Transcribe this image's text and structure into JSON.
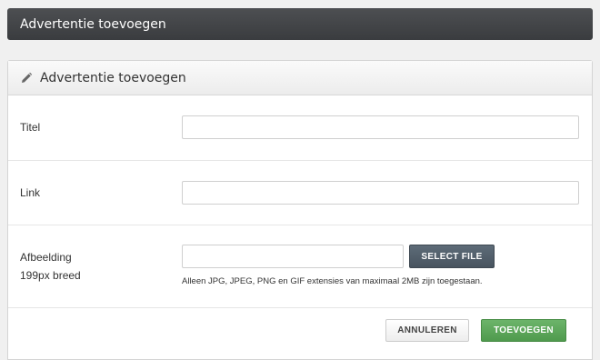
{
  "page": {
    "title": "Advertentie toevoegen"
  },
  "panel": {
    "title": "Advertentie toevoegen",
    "icon": "pencil-icon"
  },
  "form": {
    "title_label": "Titel",
    "title_value": "",
    "link_label": "Link",
    "link_value": "",
    "image_label": "Afbeelding",
    "image_sublabel": "199px breed",
    "image_file_value": "",
    "select_file_label": "SELECT FILE",
    "image_hint": "Alleen JPG, JPEG, PNG en GIF extensies van maximaal 2MB zijn toegestaan."
  },
  "actions": {
    "cancel_label": "ANNULEREN",
    "submit_label": "TOEVOEGEN"
  },
  "colors": {
    "topbar": "#3f4144",
    "submit": "#5aa858",
    "select_file": "#525e69"
  }
}
